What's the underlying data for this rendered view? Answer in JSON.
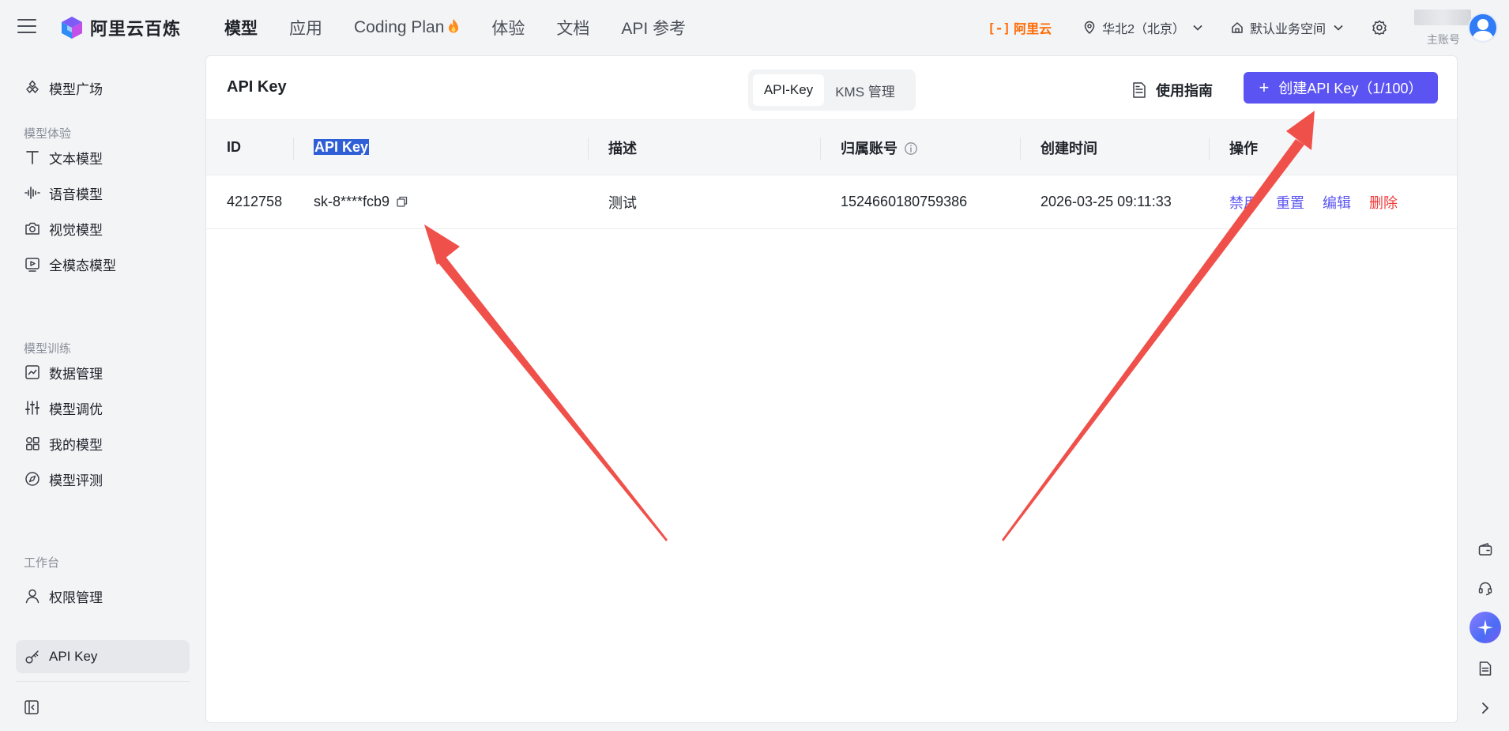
{
  "brand": {
    "name": "阿里云百炼"
  },
  "topnav": {
    "items": [
      "模型",
      "应用",
      "Coding Plan",
      "体验",
      "文档",
      "API 参考"
    ]
  },
  "topright": {
    "aliyun_mark": "[-]",
    "aliyun_text": "阿里云",
    "region": "华北2（北京）",
    "workspace": "默认业务空间",
    "account_label": "主账号"
  },
  "sidebar": {
    "items": [
      {
        "label": "模型广场",
        "icon": "cube-icon"
      },
      {
        "group": "模型体验"
      },
      {
        "label": "文本模型",
        "icon": "text-icon"
      },
      {
        "label": "语音模型",
        "icon": "waveform-icon"
      },
      {
        "label": "视觉模型",
        "icon": "camera-icon"
      },
      {
        "label": "全模态模型",
        "icon": "play-box-icon"
      },
      {
        "group": "模型训练"
      },
      {
        "label": "数据管理",
        "icon": "chart-line-icon"
      },
      {
        "label": "模型调优",
        "icon": "sliders-icon"
      },
      {
        "label": "我的模型",
        "icon": "grid-icon"
      },
      {
        "label": "模型评测",
        "icon": "compass-icon"
      },
      {
        "group": "工作台"
      },
      {
        "label": "权限管理",
        "icon": "user-icon"
      },
      {
        "label": "API Key",
        "icon": "key-icon",
        "active": true
      }
    ]
  },
  "panel": {
    "title": "API Key",
    "tabs": [
      "API-Key",
      "KMS 管理"
    ],
    "active_tab": "API-Key",
    "guide_label": "使用指南",
    "create_label": "创建API Key（1/100）"
  },
  "table": {
    "headers": [
      "ID",
      "API Key",
      "描述",
      "归属账号",
      "创建时间",
      "操作"
    ],
    "rows": [
      {
        "id": "4212758",
        "key": "sk-8****fcb9",
        "desc": "测试",
        "account": "1524660180759386",
        "created": "2026-03-25 09:11:33",
        "ops": [
          "禁用",
          "重置",
          "编辑",
          "删除"
        ]
      }
    ]
  },
  "colors": {
    "accent": "#5b54f2",
    "danger": "#f03a3a",
    "brand_orange": "#ff6a00",
    "annotation_arrow": "#f0504a"
  }
}
